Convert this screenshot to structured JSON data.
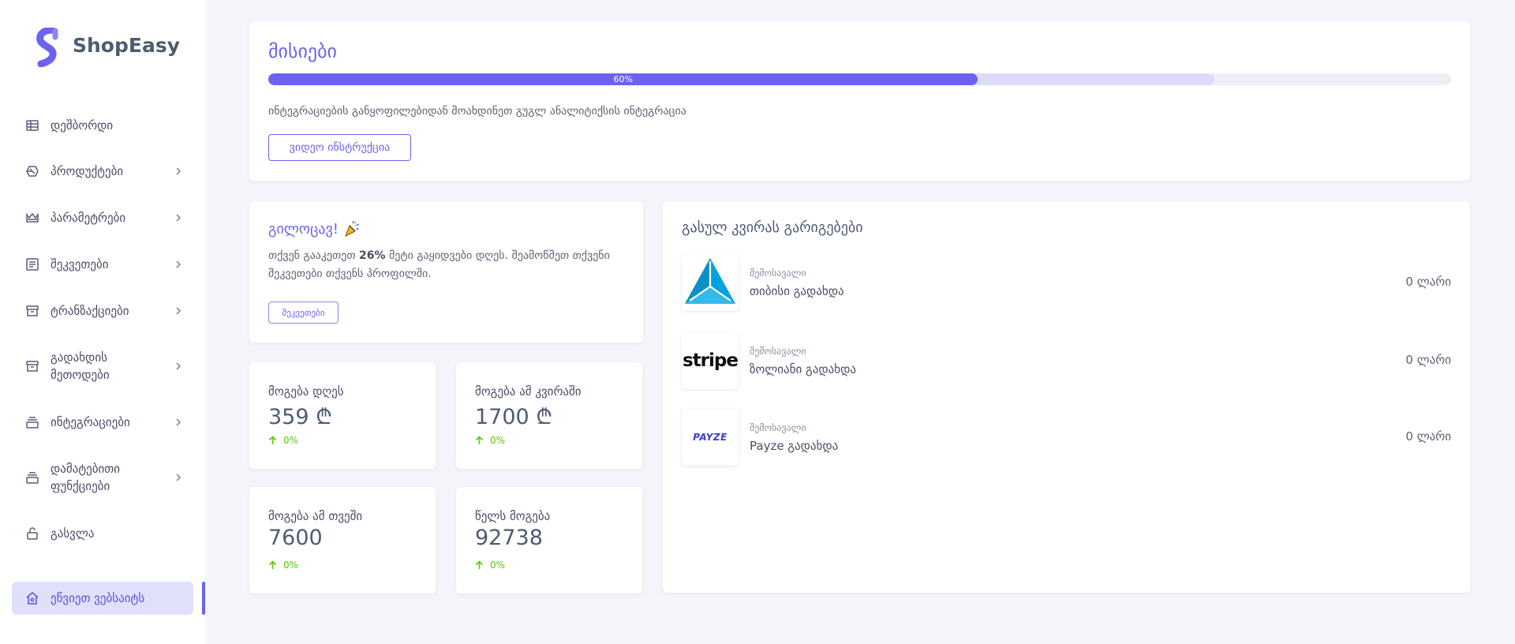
{
  "brand": {
    "name": "ShopEasy"
  },
  "colors": {
    "accent": "#6b63f0",
    "positive": "#56ca00",
    "background": "#f4f5fa"
  },
  "sidebar": {
    "items": [
      {
        "label": "დეშბორდი",
        "icon": "grid-icon",
        "has_submenu": false
      },
      {
        "label": "პროდუქტები",
        "icon": "box-icon",
        "has_submenu": true
      },
      {
        "label": "პარამეტრები",
        "icon": "crown-icon",
        "has_submenu": true
      },
      {
        "label": "შეკვეთები",
        "icon": "list-icon",
        "has_submenu": true
      },
      {
        "label": "ტრანზაქციები",
        "icon": "archive-icon",
        "has_submenu": true
      },
      {
        "label": "გადახდის მეთოდები",
        "icon": "archive-icon",
        "has_submenu": true
      },
      {
        "label": "ინტეგრაციები",
        "icon": "stack-icon",
        "has_submenu": true
      },
      {
        "label": "დამატებითი ფუნქციები",
        "icon": "stack-icon",
        "has_submenu": true
      },
      {
        "label": "გასვლა",
        "icon": "lock-icon",
        "has_submenu": false
      }
    ],
    "active_item": {
      "label": "ეწვიეთ ვებსაიტს",
      "icon": "home-icon"
    }
  },
  "missions": {
    "title": "მისიები",
    "progress_label": "60%",
    "progress_value": 0.6,
    "progress_buffer": 0.8,
    "description": "ინტეგრაციების განყოფილებიდან მოახდინეთ გუგლ ანალიტიქსის ინტეგრაცია",
    "button_label": "ვიდეო ინსტრუქცია"
  },
  "congrats": {
    "title": "გილოცავ!",
    "text_before": "თქვენ გააკეთეთ ",
    "text_highlight": "26%",
    "text_after": " მეტი გაყიდვები დღეს. შეამოწმეთ თქვენი შეკვეთები თქვენს პროფილში.",
    "button_label": "შეკვეთები"
  },
  "stats": [
    {
      "label": "მოგება დღეს",
      "value": "359 ₾",
      "delta": "0%"
    },
    {
      "label": "მოგება ამ კვირაში",
      "value": "1700 ₾",
      "delta": "0%"
    },
    {
      "label": "მოგება ამ თვეში",
      "value": "7600",
      "delta": "0%"
    },
    {
      "label": "წელს მოგება",
      "value": "92738",
      "delta": "0%"
    }
  ],
  "earnings": {
    "title": "გასულ კვირას გარიგებები",
    "rows": [
      {
        "sub": "შემოსავალი",
        "name": "თიბისი გადახდა",
        "amount": "0 ლარი",
        "logo": "tbc-logo"
      },
      {
        "sub": "შემოსავალი",
        "name": "ზოლიანი გადახდა",
        "amount": "0 ლარი",
        "logo": "stripe-logo",
        "logo_text": "stripe"
      },
      {
        "sub": "შემოსავალი",
        "name": "Payze გადახდა",
        "amount": "0 ლარი",
        "logo": "payze-logo",
        "logo_text": "PAYZE"
      }
    ]
  }
}
